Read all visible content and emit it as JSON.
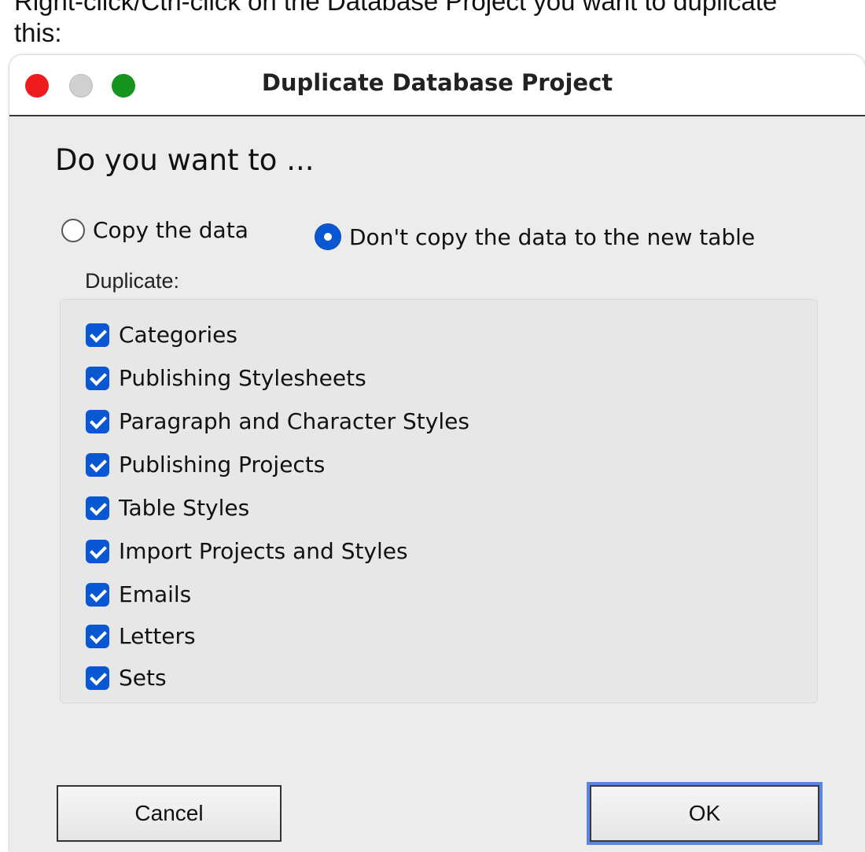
{
  "caption": {
    "line1": "Right-click/Ctrl-click on the Database Project you want to duplicate",
    "line2": "this:"
  },
  "window": {
    "title": "Duplicate Database Project"
  },
  "question": "Do you want to ...",
  "radios": [
    {
      "label": "Copy the data",
      "selected": false
    },
    {
      "label": "Don't copy the data to the new table",
      "selected": true
    }
  ],
  "group_label": "Duplicate:",
  "checkboxes": [
    {
      "label": "Categories",
      "checked": true
    },
    {
      "label": "Publishing Stylesheets",
      "checked": true
    },
    {
      "label": "Paragraph and Character Styles",
      "checked": true
    },
    {
      "label": "Publishing Projects",
      "checked": true
    },
    {
      "label": "Table Styles",
      "checked": true
    },
    {
      "label": "Import Projects and Styles",
      "checked": true
    },
    {
      "label": "Emails",
      "checked": true
    },
    {
      "label": "Letters",
      "checked": true
    },
    {
      "label": "Sets",
      "checked": true
    }
  ],
  "buttons": {
    "cancel": "Cancel",
    "ok": "OK"
  },
  "colors": {
    "accent": "#0a57d4",
    "close": "#ee1c1c",
    "minimize": "#d0d0d0",
    "zoom": "#17941f",
    "focus_ring": "#5b86e0"
  }
}
